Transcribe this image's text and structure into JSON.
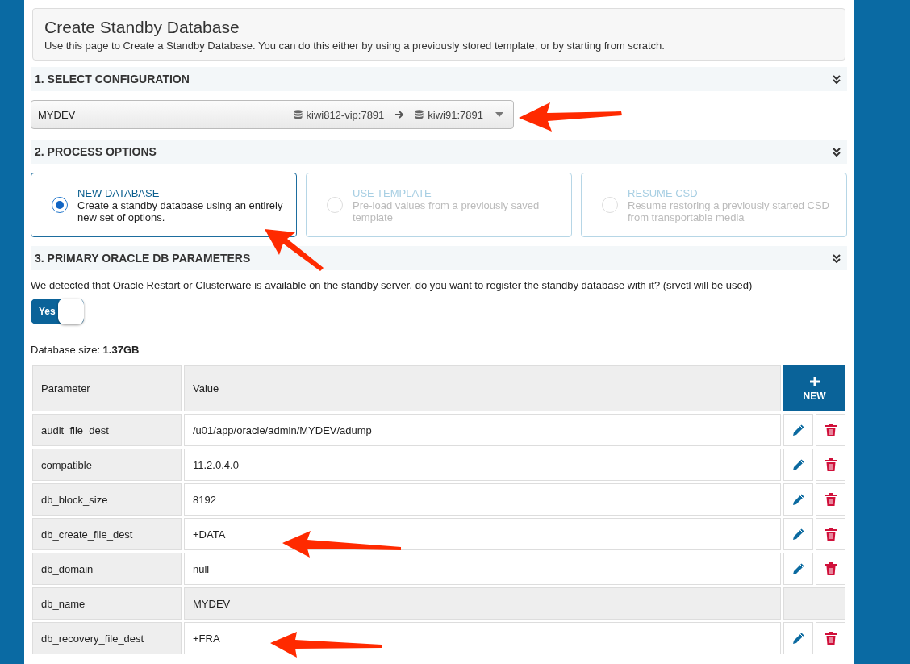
{
  "header": {
    "title": "Create Standby Database",
    "description": "Use this page to Create a Standby Database. You can do this either by using a previously stored template, or by starting from scratch."
  },
  "sections": [
    {
      "title": "1. SELECT CONFIGURATION",
      "expanded": true
    },
    {
      "title": "2. PROCESS OPTIONS",
      "expanded": true
    },
    {
      "title": "3. PRIMARY ORACLE DB PARAMETERS",
      "expanded": true
    }
  ],
  "configuration": {
    "name": "MYDEV",
    "source": "kiwi812-vip:7891",
    "target": "kiwi91:7891"
  },
  "process_options": [
    {
      "title": "NEW DATABASE",
      "description": "Create a standby database using an entirely new set of options.",
      "selected": true,
      "disabled": false
    },
    {
      "title": "USE TEMPLATE",
      "description": "Pre-load values from a previously saved template",
      "selected": false,
      "disabled": true
    },
    {
      "title": "RESUME CSD",
      "description": "Resume restoring a previously started CSD from transportable media",
      "selected": false,
      "disabled": true
    }
  ],
  "register_prompt": "We detected that Oracle Restart or Clusterware is available on the standby server, do you want to register the standby database with it? (srvctl will be used)",
  "register_toggle": {
    "label": "Yes",
    "on": true
  },
  "database_size": {
    "label": "Database size:",
    "value": "1.37GB"
  },
  "table": {
    "columns": [
      "Parameter",
      "Value"
    ],
    "new_button": "NEW",
    "rows": [
      {
        "parameter": "audit_file_dest",
        "value": "/u01/app/oracle/admin/MYDEV/adump",
        "editable": true
      },
      {
        "parameter": "compatible",
        "value": "11.2.0.4.0",
        "editable": true
      },
      {
        "parameter": "db_block_size",
        "value": "8192",
        "editable": true
      },
      {
        "parameter": "db_create_file_dest",
        "value": "+DATA",
        "editable": true
      },
      {
        "parameter": "db_domain",
        "value": "null",
        "editable": true
      },
      {
        "parameter": "db_name",
        "value": "MYDEV",
        "editable": false
      },
      {
        "parameter": "db_recovery_file_dest",
        "value": "+FRA",
        "editable": true
      }
    ]
  }
}
